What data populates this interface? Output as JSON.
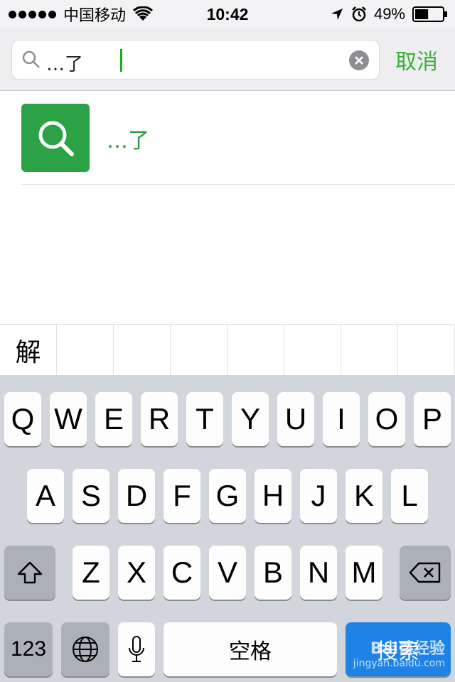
{
  "status_bar": {
    "carrier": "中国移动",
    "time": "10:42",
    "battery_percent": "49%",
    "battery_level": 0.49,
    "icons": [
      "signal-dots-icon",
      "wifi-icon",
      "location-arrow-icon",
      "alarm-clock-icon",
      "battery-icon"
    ]
  },
  "search": {
    "query": "…了",
    "cancel_label": "取消",
    "icons": [
      "magnifier-icon",
      "clear-icon"
    ]
  },
  "result": {
    "text": "…了",
    "icon": "search-icon"
  },
  "candidates": [
    "解",
    "",
    "",
    "",
    "",
    "",
    "",
    ""
  ],
  "keyboard": {
    "row1": [
      "Q",
      "W",
      "E",
      "R",
      "T",
      "Y",
      "U",
      "I",
      "O",
      "P"
    ],
    "row2": [
      "A",
      "S",
      "D",
      "F",
      "G",
      "H",
      "J",
      "K",
      "L"
    ],
    "row3": [
      "Z",
      "X",
      "C",
      "V",
      "B",
      "N",
      "M"
    ],
    "numbers_label": "123",
    "space_label": "空格",
    "return_label": "搜索",
    "icons": [
      "shift-icon",
      "backspace-icon",
      "globe-icon",
      "microphone-icon"
    ]
  },
  "watermark": {
    "brand": "Bai百经验",
    "url": "jingyan.baidu.com"
  },
  "colors": {
    "accent_green": "#3cb034",
    "result_icon_bg": "#2ba245",
    "return_key_bg": "#1f83e6"
  }
}
